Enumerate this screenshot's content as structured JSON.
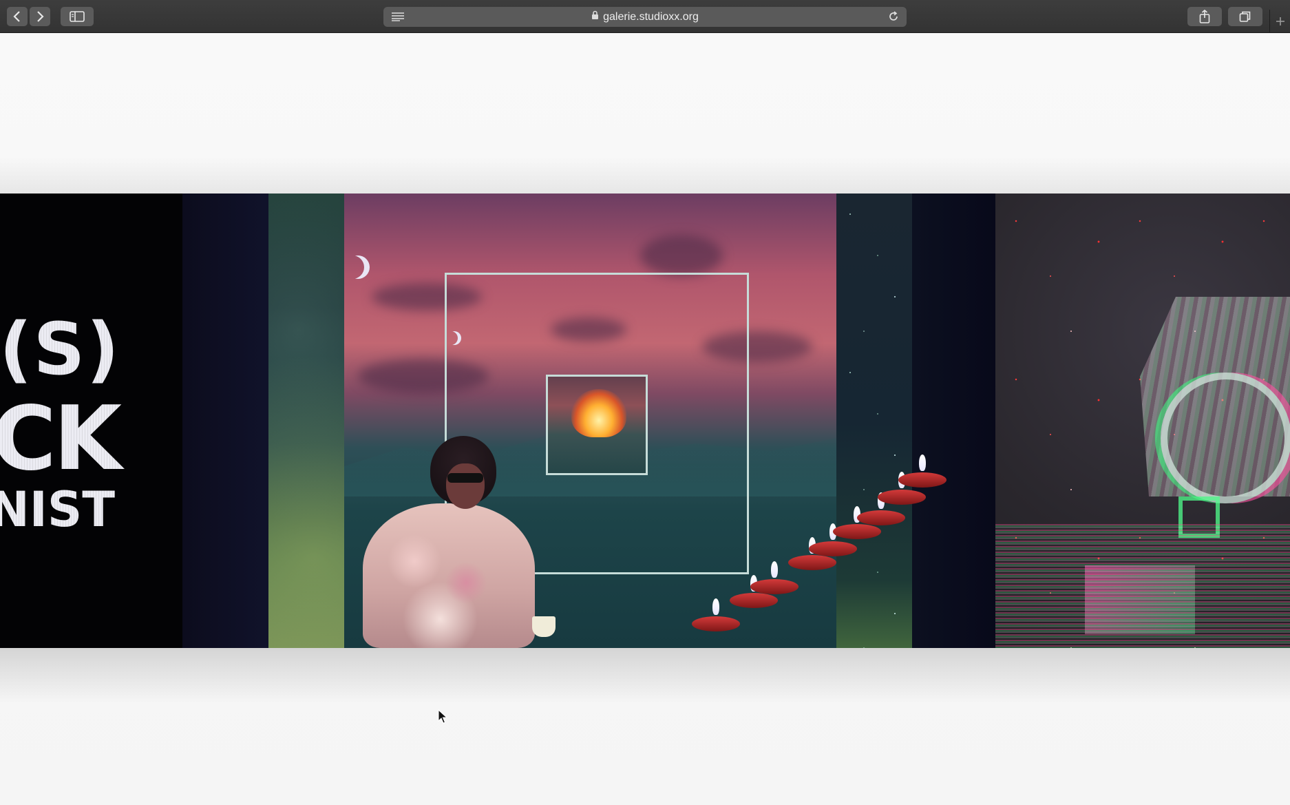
{
  "browser": {
    "url": "galerie.studioxx.org",
    "icons": {
      "back": "chevron-left-icon",
      "forward": "chevron-right-icon",
      "sidebar": "sidebar-icon",
      "reader": "reader-lines-icon",
      "lock": "lock-icon",
      "reload": "reload-icon",
      "share": "share-icon",
      "tabs": "tabs-icon",
      "new_tab": "plus-icon"
    }
  },
  "carousel": {
    "slide_text": {
      "line1": "E(S)",
      "line2": "CK",
      "line3": "ANIST"
    },
    "slides": [
      "text-panel",
      "collage-artwork",
      "glitch-artwork"
    ]
  },
  "colors": {
    "toolbar": "#383838",
    "page_background": "#f6f6f6",
    "frame_border": "#c6dcd8"
  }
}
